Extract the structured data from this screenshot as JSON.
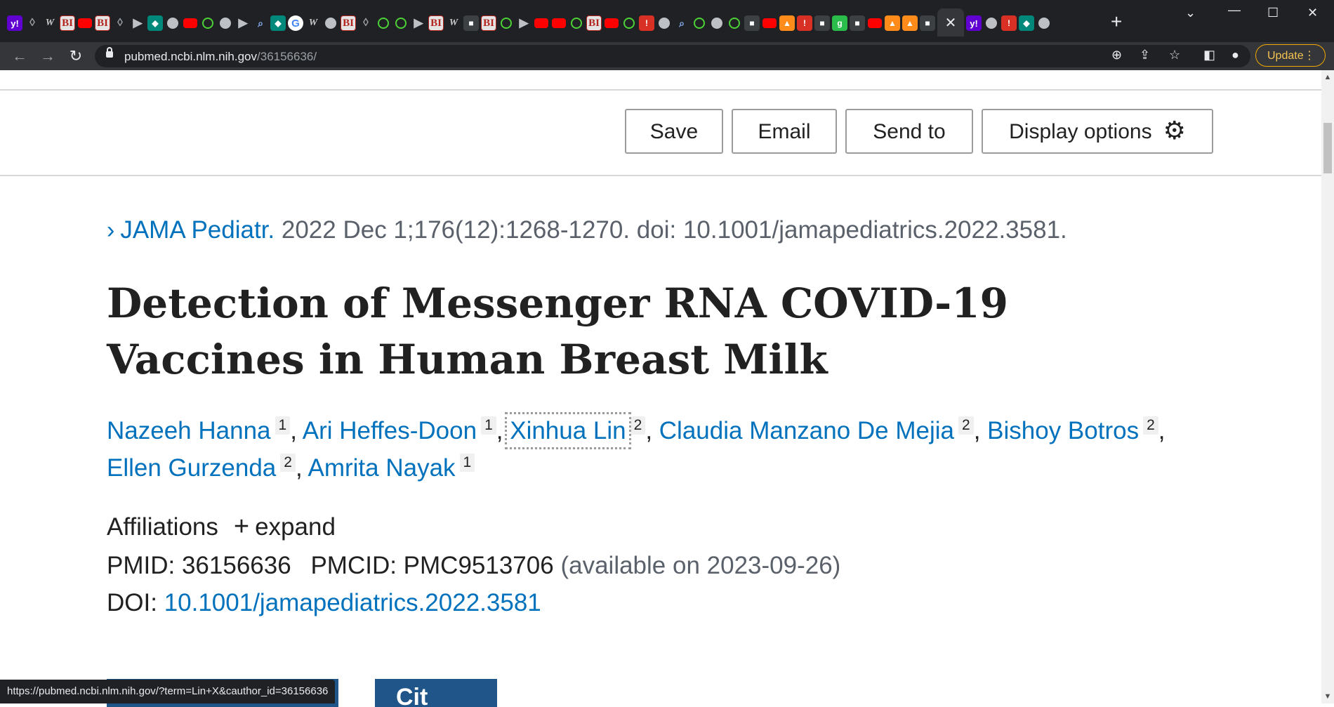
{
  "browser": {
    "url_host": "pubmed.ncbi.nlm.nih.gov",
    "url_path": "/36156636/",
    "update_label": "Update",
    "active_tab_close": "✕",
    "newtab_glyph": "+",
    "tab_favicons": [
      "yahoo",
      "shield",
      "wiki",
      "bi",
      "yt",
      "bi",
      "shield",
      "flag",
      "teal",
      "globe",
      "yt",
      "play",
      "globe",
      "flag",
      "mag",
      "teal",
      "g",
      "wiki",
      "globe",
      "bi",
      "shield",
      "play",
      "play",
      "flag",
      "bi",
      "wiki",
      "dark",
      "bi",
      "play",
      "flag",
      "yt",
      "yt",
      "play",
      "bi",
      "yt",
      "play",
      "red",
      "globe",
      "mag",
      "play",
      "globe",
      "play",
      "dark",
      "yt",
      "orange",
      "red",
      "dark",
      "green",
      "dark",
      "yt",
      "orange",
      "orange",
      "dark"
    ],
    "tab_favicons_after": [
      "yahoo",
      "globe",
      "red",
      "teal",
      "globe"
    ],
    "status_url": "https://pubmed.ncbi.nlm.nih.gov/?term=Lin+X&cauthor_id=36156636"
  },
  "actions": {
    "save": "Save",
    "email": "Email",
    "send_to": "Send to",
    "display_options": "Display options"
  },
  "article": {
    "journal": "JAMA Pediatr.",
    "citation": " 2022 Dec 1;176(12):1268-1270. doi: 10.1001/jamapediatrics.2022.3581.",
    "title": "Detection of Messenger RNA COVID-19 Vaccines in Human Breast Milk",
    "authors": [
      {
        "name": "Nazeeh Hanna",
        "aff": "1"
      },
      {
        "name": "Ari Heffes-Doon",
        "aff": "1"
      },
      {
        "name": "Xinhua Lin",
        "aff": "2"
      },
      {
        "name": "Claudia Manzano De Mejia",
        "aff": "2"
      },
      {
        "name": "Bishoy Botros",
        "aff": "2"
      },
      {
        "name": "Ellen Gurzenda",
        "aff": "2"
      },
      {
        "name": "Amrita Nayak",
        "aff": "1"
      }
    ],
    "affiliations_label": "Affiliations",
    "expand_label": "expand",
    "pmid_label": "PMID:",
    "pmid": "36156636",
    "pmcid_label": "PMCID:",
    "pmcid": "PMC9513706",
    "pmc_available": "(available on 2023-09-26)",
    "doi_label": "DOI:",
    "doi": "10.1001/jamapediatrics.2022.3581",
    "cite_label": "Cit"
  }
}
